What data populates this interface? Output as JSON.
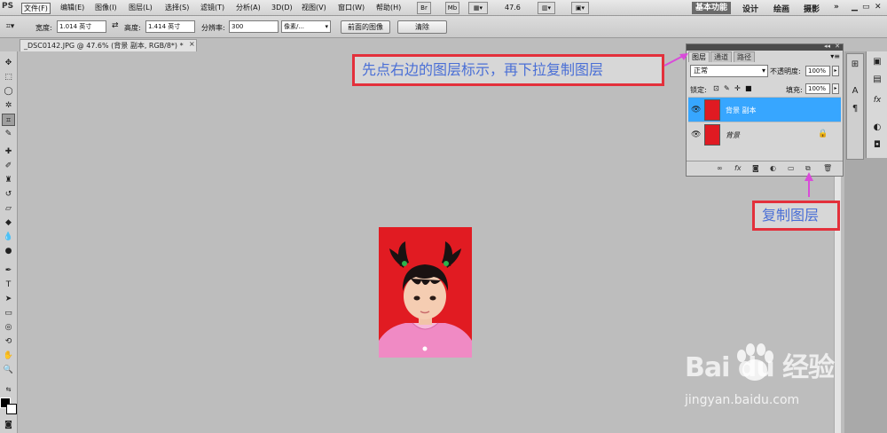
{
  "menubar": {
    "logo": "PS",
    "items": [
      "文件(F)",
      "编辑(E)",
      "图像(I)",
      "图层(L)",
      "选择(S)",
      "滤镜(T)",
      "分析(A)",
      "3D(D)",
      "视图(V)",
      "窗口(W)",
      "帮助(H)"
    ],
    "zoom": "47.6",
    "workspaces": [
      "基本功能",
      "设计",
      "绘画",
      "摄影"
    ],
    "more": "»"
  },
  "options": {
    "width_label": "宽度:",
    "width_value": "1.014 英寸",
    "height_label": "高度:",
    "height_value": "1.414 英寸",
    "resolution_label": "分辨率:",
    "resolution_value": "300",
    "resolution_unit": "像素/...",
    "front_image_button": "前面的图像",
    "clear_button": "清除"
  },
  "document": {
    "tab_title": "_DSC0142.JPG @ 47.6% (背景 副本, RGB/8*) *",
    "close": "×"
  },
  "layers_panel": {
    "tabs": [
      "图层",
      "通道",
      "路径"
    ],
    "blend_mode": "正常",
    "opacity_label": "不透明度:",
    "opacity_value": "100%",
    "lock_label": "锁定:",
    "fill_label": "填充:",
    "fill_value": "100%",
    "layers": [
      {
        "name": "背景 副本",
        "selected": true
      },
      {
        "name": "背景",
        "selected": false
      }
    ]
  },
  "annotations": {
    "top": "先点右边的图层标示，再下拉复制图层",
    "bottom": "复制图层",
    "color": "#e3303b",
    "arrow_color": "#d94bd9"
  },
  "watermark": {
    "brand": "Bai du 经验",
    "site": "jingyan.baidu.com"
  }
}
